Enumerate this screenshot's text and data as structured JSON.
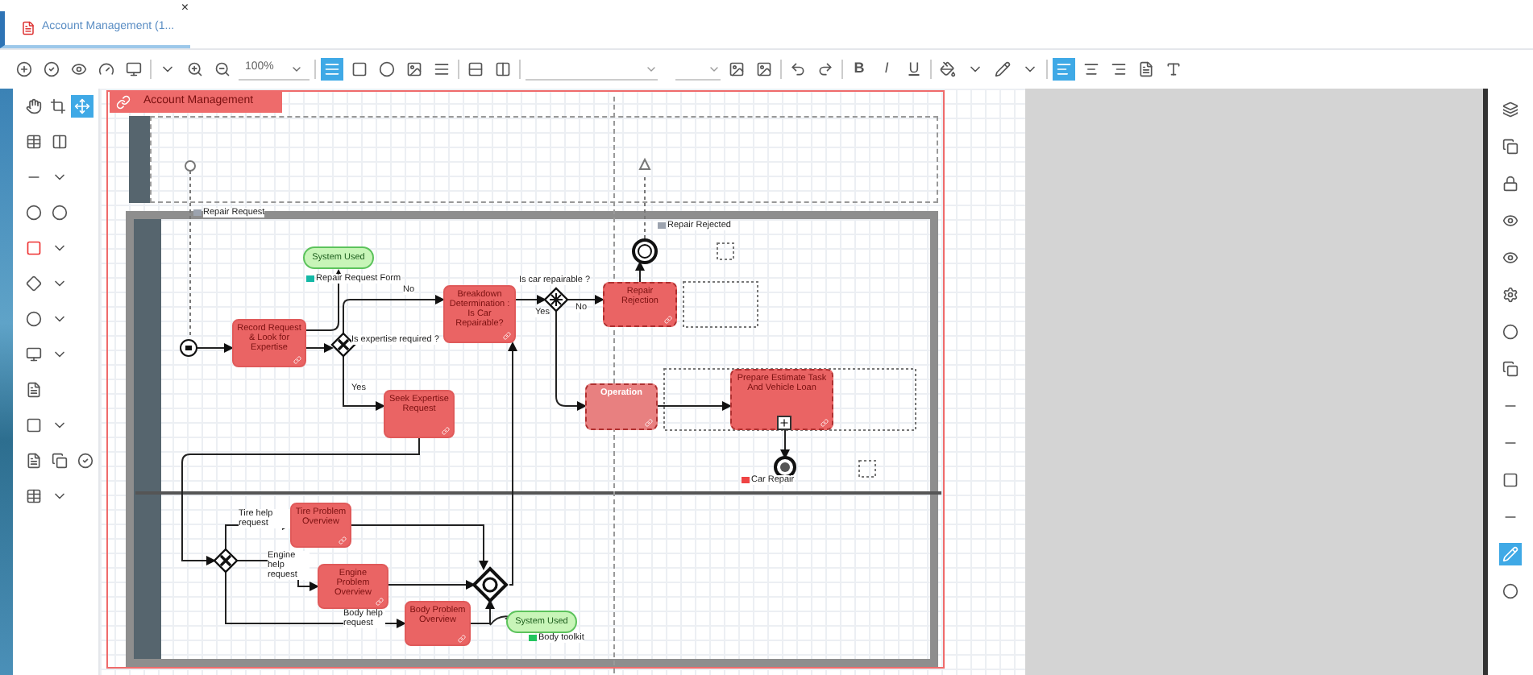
{
  "tab": {
    "label": "Account Management (1...",
    "close": "×",
    "selected": true
  },
  "toolbar": {
    "zoom": "100%",
    "layout_buttons": [
      {
        "selected": true
      },
      {
        "selected": false
      },
      {
        "selected": false
      },
      {
        "selected": false
      },
      {
        "selected": false
      }
    ],
    "text_styles": [
      "B",
      "I",
      "U"
    ],
    "text_align": [
      {
        "selected": true
      },
      {
        "selected": false
      },
      {
        "selected": false
      },
      {
        "selected": false
      }
    ]
  },
  "palette": {
    "tools": [
      {
        "selected": false
      },
      {
        "selected": false
      },
      {
        "selected": true
      }
    ]
  },
  "right_tools": [
    {
      "selected": false
    },
    {
      "selected": false
    },
    {
      "selected": false
    },
    {
      "selected": false
    },
    {
      "selected": false
    },
    {
      "selected": false
    },
    {
      "selected": false
    },
    {
      "selected": false
    },
    {
      "selected": false
    },
    {
      "selected": false
    },
    {
      "selected": false
    },
    {
      "selected": false
    },
    {
      "selected": true
    },
    {
      "selected": false
    }
  ],
  "diagram": {
    "pool_title": "Account Management",
    "tasks": [
      {
        "text": "Record Request & Look for Expertise",
        "kind": "task",
        "highlighted": false
      },
      {
        "text": "Breakdown Determination : Is Car Repairable?",
        "kind": "task",
        "highlighted": false
      },
      {
        "text": "Seek Expertise Request",
        "kind": "task",
        "highlighted": false
      },
      {
        "text": "Repair Rejection",
        "kind": "task",
        "highlighted": true
      },
      {
        "text": "Operation",
        "kind": "operation",
        "highlighted": true
      },
      {
        "text": "Prepare Estimate Task And Vehicle Loan",
        "kind": "subprocess",
        "highlighted": true
      },
      {
        "text": "Tire Problem Overview",
        "kind": "task",
        "highlighted": false
      },
      {
        "text": "Engine Problem Overview",
        "kind": "task",
        "highlighted": false
      },
      {
        "text": "Body Problem Overview",
        "kind": "task",
        "highlighted": false
      }
    ],
    "gateways": [
      {
        "kind": "exclusive"
      },
      {
        "kind": "complex"
      },
      {
        "kind": "exclusive"
      },
      {
        "kind": "event"
      }
    ],
    "events": [
      {
        "kind": "start"
      },
      {
        "kind": "intermediate"
      },
      {
        "kind": "end"
      }
    ],
    "systems": [
      {
        "text": "System Used"
      },
      {
        "text": "System Used"
      }
    ],
    "labels": [
      {
        "text": "Repair Request",
        "color": "#9ca3af"
      },
      {
        "text": "Repair Request Form",
        "color": "#14b8a6"
      },
      {
        "text": "No"
      },
      {
        "text": "Is expertise required ?"
      },
      {
        "text": "Yes"
      },
      {
        "text": "Is car repairable ?"
      },
      {
        "text": "Yes"
      },
      {
        "text": "No"
      },
      {
        "text": "Repair Rejected",
        "color": "#9ca3af"
      },
      {
        "text": "Car Repair",
        "color": "#ef4444"
      },
      {
        "text": "Tire help request"
      },
      {
        "text": "Engine help request"
      },
      {
        "text": "Body help request"
      },
      {
        "text": "Body toolkit",
        "color": "#22c55e"
      }
    ]
  }
}
